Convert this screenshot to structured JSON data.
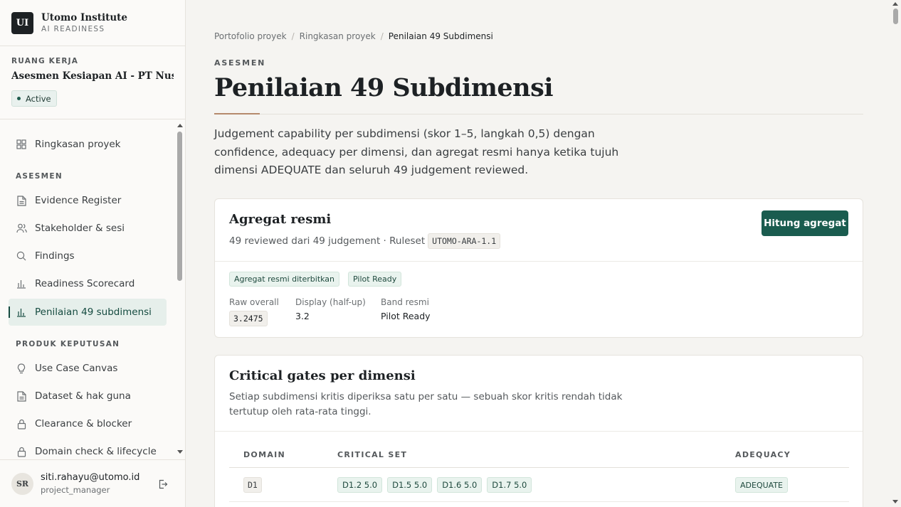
{
  "brand": {
    "logo": "UI",
    "name": "Utomo Institute",
    "subtitle": "AI READINESS"
  },
  "workspace": {
    "label": "RUANG KERJA",
    "name": "Asesmen Kesiapan AI - PT Nusa...",
    "status": "Active"
  },
  "nav": {
    "overview": {
      "label": "Ringkasan proyek",
      "icon": "grid-icon"
    },
    "section_asesmen": "ASESMEN",
    "evidence": {
      "label": "Evidence Register",
      "icon": "document-icon"
    },
    "stakeholder": {
      "label": "Stakeholder & sesi",
      "icon": "users-icon"
    },
    "findings": {
      "label": "Findings",
      "icon": "search-icon"
    },
    "scorecard": {
      "label": "Readiness Scorecard",
      "icon": "bar-chart-icon"
    },
    "penilaian": {
      "label": "Penilaian 49 subdimensi",
      "icon": "bar-chart-icon"
    },
    "section_produk": "PRODUK KEPUTUSAN",
    "usecase": {
      "label": "Use Case Canvas",
      "icon": "lightbulb-icon"
    },
    "dataset": {
      "label": "Dataset & hak guna",
      "icon": "document-icon"
    },
    "clearance": {
      "label": "Clearance & blocker",
      "icon": "lock-icon"
    },
    "domain": {
      "label": "Domain check & lifecycle",
      "icon": "lock-icon"
    }
  },
  "user": {
    "initials": "SR",
    "email": "siti.rahayu@utomo.id",
    "role": "project_manager"
  },
  "breadcrumb": [
    "Portofolio proyek",
    "Ringkasan proyek",
    "Penilaian 49 Subdimensi"
  ],
  "page": {
    "eyebrow": "ASESMEN",
    "title": "Penilaian 49 Subdimensi",
    "lead": "Judgement capability per subdimensi (skor 1–5, langkah 0,5) dengan confidence, adequacy per dimensi, dan agregat resmi hanya ketika tujuh dimensi ADEQUATE dan seluruh 49 judgement reviewed."
  },
  "aggregate": {
    "title": "Agregat resmi",
    "summary": "49 reviewed dari 49 judgement · Ruleset",
    "ruleset": "UTOMO-ARA-1.1",
    "button": "Hitung agregat",
    "tags": [
      "Agregat resmi diterbitkan",
      "Pilot Ready"
    ],
    "raw_label": "Raw overall",
    "raw_value": "3.2475",
    "display_label": "Display (half-up)",
    "display_value": "3.2",
    "band_label": "Band resmi",
    "band_value": "Pilot Ready"
  },
  "gates": {
    "title": "Critical gates per dimensi",
    "description": "Setiap subdimensi kritis diperiksa satu per satu — sebuah skor kritis rendah tidak tertutup oleh rata-rata tinggi.",
    "columns": [
      "DOMAIN",
      "CRITICAL SET",
      "ADEQUACY"
    ],
    "rows": [
      {
        "domain": "D1",
        "critical": [
          "D1.2 5.0",
          "D1.5 5.0",
          "D1.6 5.0",
          "D1.7 5.0"
        ],
        "adequacy": "ADEQUATE"
      }
    ]
  },
  "colors": {
    "accent": "#1a5c4f",
    "rule_accent": "#b58a6c"
  }
}
